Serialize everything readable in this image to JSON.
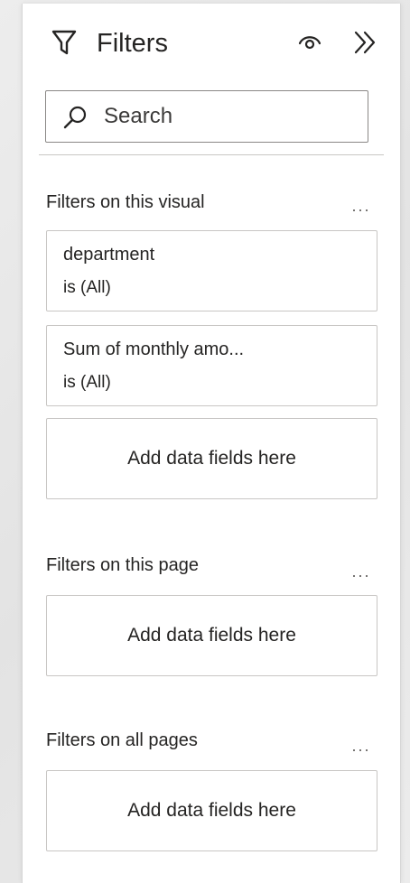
{
  "header": {
    "title": "Filters",
    "icons": {
      "title": "filter-funnel-icon",
      "visibility": "eye-icon",
      "collapse": "double-chevron-right-icon"
    }
  },
  "search": {
    "placeholder": "Search",
    "value": ""
  },
  "sections": {
    "visual": {
      "title": "Filters on this visual",
      "more": "...",
      "cards": [
        {
          "field": "department",
          "condition": "is (All)"
        },
        {
          "field": "Sum of monthly amo...",
          "condition": "is (All)"
        }
      ],
      "drop_label": "Add data fields here"
    },
    "page": {
      "title": "Filters on this page",
      "more": "...",
      "drop_label": "Add data fields here"
    },
    "all_pages": {
      "title": "Filters on all pages",
      "more": "...",
      "drop_label": "Add data fields here"
    }
  },
  "colors": {
    "text": "#252423",
    "border": "#c8c6c4",
    "input_border": "#8a8886",
    "background": "#ffffff"
  }
}
